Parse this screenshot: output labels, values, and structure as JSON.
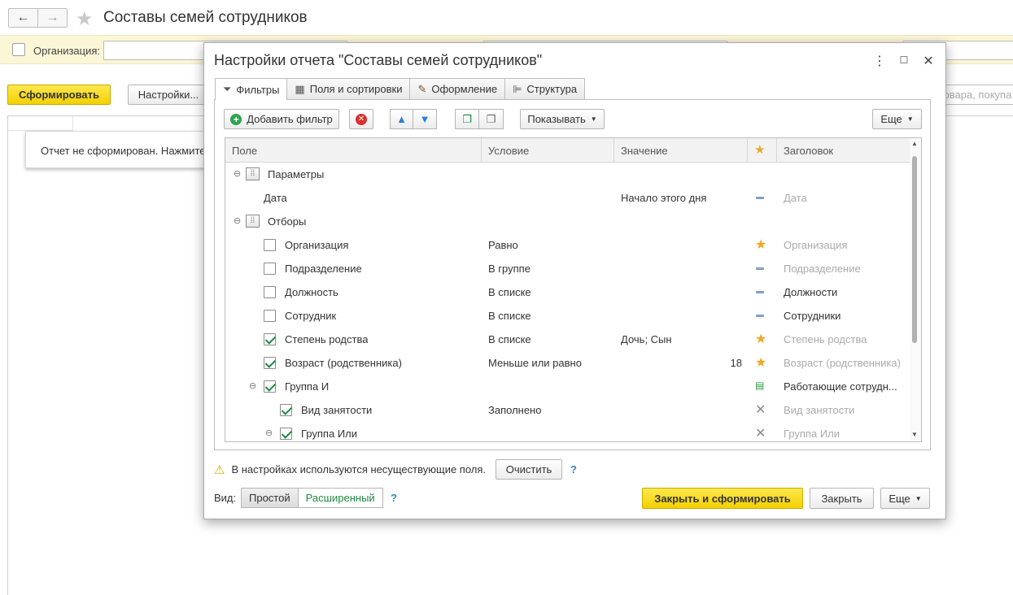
{
  "background": {
    "title": "Составы семей сотрудников",
    "org_label": "Организация:",
    "form_button": "Сформировать",
    "settings_button": "Настройки...",
    "search_placeholder": "ювара, покупа",
    "notice": "Отчет не сформирован. Нажмите"
  },
  "dialog": {
    "title": "Настройки отчета \"Составы семей сотрудников\"",
    "tabs": [
      {
        "label": "Фильтры",
        "icon": "funnel-icon"
      },
      {
        "label": "Поля и сортировки",
        "icon": "table-icon"
      },
      {
        "label": "Оформление",
        "icon": "brush-icon"
      },
      {
        "label": "Структура",
        "icon": "structure-icon"
      }
    ],
    "toolbar": {
      "add_filter": "Добавить фильтр",
      "show": "Показывать",
      "more": "Еще"
    },
    "columns": [
      "Поле",
      "Условие",
      "Значение",
      "★",
      "Заголовок"
    ],
    "rows": [
      {
        "field": "Параметры",
        "condition": "",
        "value": "",
        "marker": "",
        "header": "",
        "kind": "group",
        "level": 0
      },
      {
        "field": "Дата",
        "condition": "",
        "value": "Начало этого дня",
        "marker": "dash",
        "header": "Дата",
        "header_dim": true,
        "kind": "param",
        "level": 1
      },
      {
        "field": "Отборы",
        "condition": "",
        "value": "",
        "marker": "",
        "header": "",
        "kind": "group",
        "level": 0
      },
      {
        "field": "Организация",
        "condition": "Равно",
        "value": "",
        "marker": "star",
        "header": "Организация",
        "header_dim": true,
        "checked": false,
        "level": 1
      },
      {
        "field": "Подразделение",
        "condition": "В группе",
        "value": "",
        "marker": "dash",
        "header": "Подразделение",
        "header_dim": true,
        "checked": false,
        "level": 1
      },
      {
        "field": "Должность",
        "condition": "В списке",
        "value": "",
        "marker": "dash",
        "header": "Должности",
        "header_dim": false,
        "checked": false,
        "level": 1
      },
      {
        "field": "Сотрудник",
        "condition": "В списке",
        "value": "",
        "marker": "dash",
        "header": "Сотрудники",
        "header_dim": false,
        "checked": false,
        "level": 1
      },
      {
        "field": "Степень родства",
        "condition": "В списке",
        "value": "Дочь; Сын",
        "marker": "star",
        "header": "Степень родства",
        "header_dim": true,
        "checked": true,
        "level": 1
      },
      {
        "field": "Возраст (родственника)",
        "condition": "Меньше или равно",
        "value": "18",
        "value_right": true,
        "marker": "star",
        "header": "Возраст (родственника)",
        "header_dim": true,
        "checked": true,
        "level": 1
      },
      {
        "field": "Группа И",
        "condition": "",
        "value": "",
        "marker": "group",
        "header": "Работающие сотрудн...",
        "header_dim": false,
        "checked": true,
        "level": 1,
        "toggle": true
      },
      {
        "field": "Вид занятости",
        "condition": "Заполнено",
        "value": "",
        "marker": "cross",
        "header": "Вид занятости",
        "header_dim": true,
        "checked": true,
        "level": 2
      },
      {
        "field": "Группа Или",
        "condition": "",
        "value": "",
        "marker": "cross",
        "header": "Группа Или",
        "header_dim": true,
        "checked": true,
        "level": 2,
        "toggle": true
      }
    ],
    "warning": "В настройках используются несуществующие поля.",
    "clear_button": "Очистить",
    "help": "?",
    "view_label": "Вид:",
    "view_simple": "Простой",
    "view_extended": "Расширенный",
    "close_and_form": "Закрыть и сформировать",
    "close": "Закрыть",
    "more": "Еще"
  }
}
